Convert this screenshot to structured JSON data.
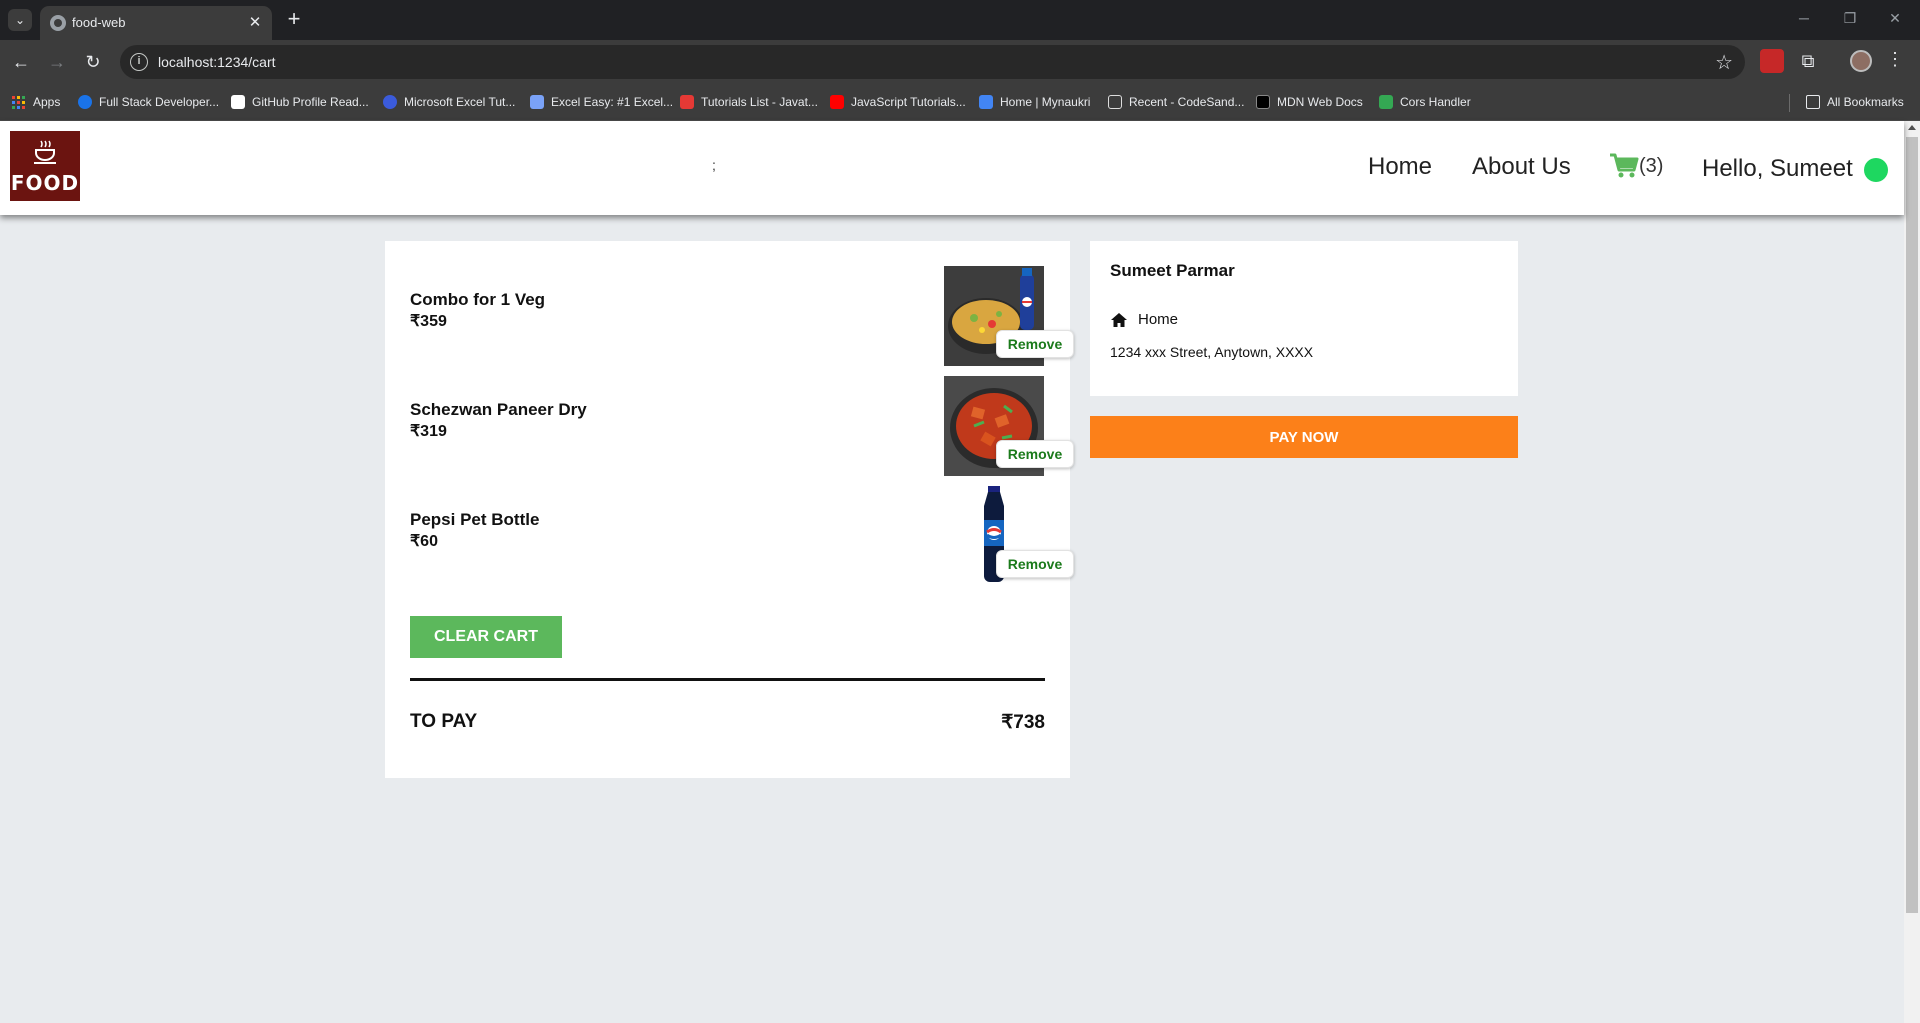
{
  "browser": {
    "tab_title": "food-web",
    "url": "localhost:1234/cart",
    "bookmarks": [
      {
        "label": "Apps",
        "color": "#fbbc04"
      },
      {
        "label": "Full Stack Developer...",
        "color": "#1a73e8"
      },
      {
        "label": "GitHub Profile Read...",
        "color": "#ffffff"
      },
      {
        "label": "Microsoft Excel Tut...",
        "color": "#3b5bdb"
      },
      {
        "label": "Excel Easy: #1 Excel...",
        "color": "#7aa2f7"
      },
      {
        "label": "Tutorials List - Javat...",
        "color": "#e53935"
      },
      {
        "label": "JavaScript Tutorials...",
        "color": "#ff0000"
      },
      {
        "label": "Home | Mynaukri",
        "color": "#4285f4"
      },
      {
        "label": "Recent - CodeSand...",
        "color": "#dddddd"
      },
      {
        "label": "MDN Web Docs",
        "color": "#000000"
      },
      {
        "label": "Cors Handler",
        "color": "#34a853"
      }
    ],
    "all_bookmarks": "All Bookmarks"
  },
  "header": {
    "logo_text": "FOOD",
    "center_text": ";",
    "nav": {
      "home": "Home",
      "about": "About Us"
    },
    "cart_count": "(3)",
    "greeting": "Hello, Sumeet",
    "status_color": "#1ed760"
  },
  "cart": {
    "items": [
      {
        "name": "Combo for 1 Veg",
        "price": "₹359",
        "remove": "Remove"
      },
      {
        "name": "Schezwan Paneer Dry",
        "price": "₹319",
        "remove": "Remove"
      },
      {
        "name": "Pepsi Pet Bottle",
        "price": "₹60",
        "remove": "Remove"
      }
    ],
    "clear_label": "CLEAR CART",
    "to_pay_label": "TO PAY",
    "to_pay_value": "₹738"
  },
  "address": {
    "name": "Sumeet Parmar",
    "type": "Home",
    "line": "1234 xxx Street, Anytown, XXXX"
  },
  "pay_label": "PAY NOW",
  "colors": {
    "accent": "#fc8019",
    "clear": "#5cb85c",
    "remove_text": "#1b7a1b",
    "logo_bg": "#6b1410"
  }
}
